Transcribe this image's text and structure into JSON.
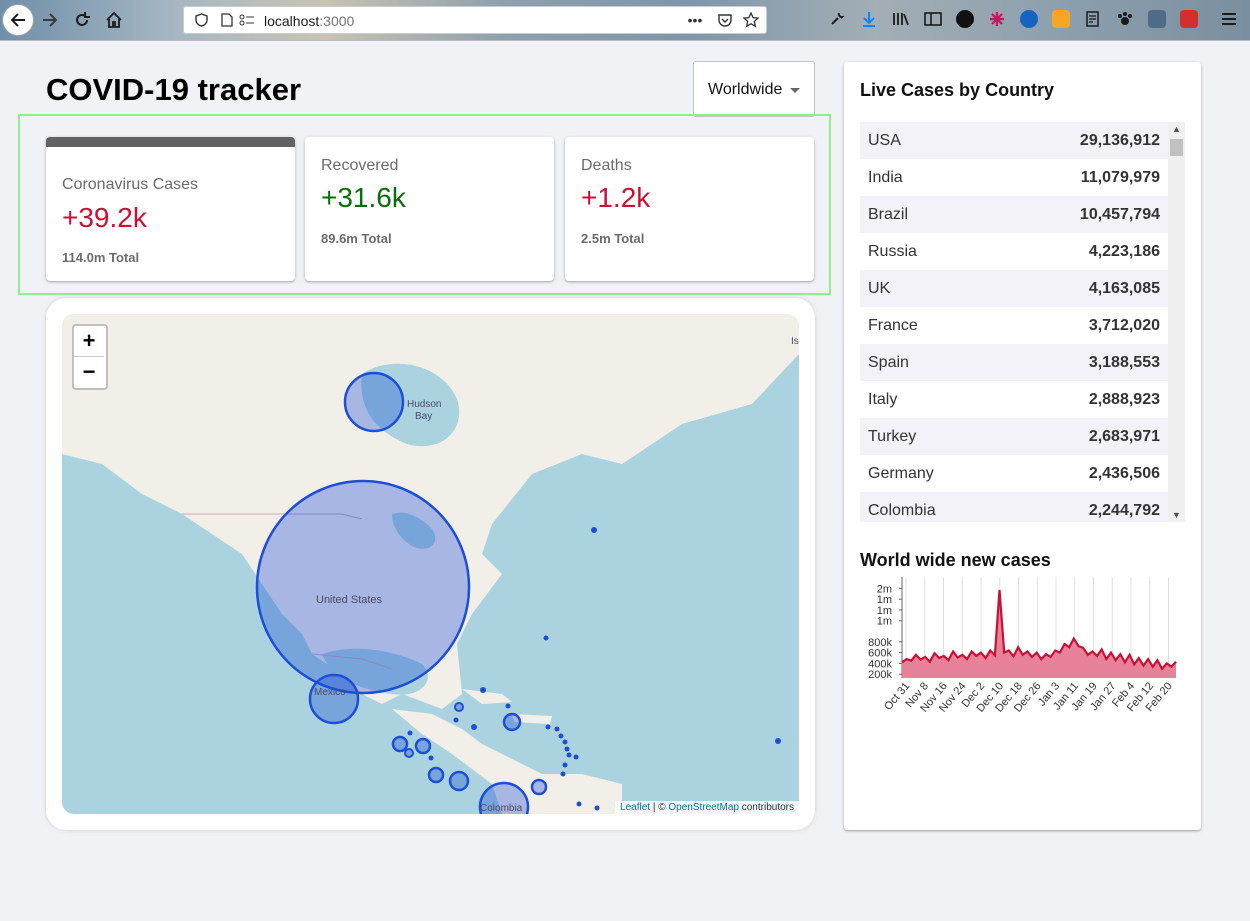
{
  "browser": {
    "url_host": "localhost",
    "url_port": ":3000"
  },
  "app": {
    "title": "COVID-19 tracker",
    "country_select": {
      "value": "Worldwide"
    }
  },
  "info_boxes": [
    {
      "title": "Coronavirus Cases",
      "value": "+39.2k",
      "total": "114.0m Total",
      "value_color": "#cc1034",
      "selected": true
    },
    {
      "title": "Recovered",
      "value": "+31.6k",
      "total": "89.6m Total",
      "value_color": "#0a6e0a",
      "selected": false
    },
    {
      "title": "Deaths",
      "value": "+1.2k",
      "total": "2.5m Total",
      "value_color": "#cc1034",
      "selected": false
    }
  ],
  "map": {
    "zoom_in": "+",
    "zoom_out": "−",
    "labels": {
      "hudson_line1": "Hudson",
      "hudson_line2": "Bay",
      "usa": "United States",
      "mexico": "Mexico",
      "colombia": "Colombia",
      "corner": "Is"
    },
    "attribution": {
      "leaflet": "Leaflet",
      "sep": " | © ",
      "osm": "OpenStreetMap",
      "suffix": " contributors"
    },
    "circle_color": "#1d4ed8"
  },
  "sidebar": {
    "table_title": "Live Cases by Country",
    "countries": [
      {
        "country": "USA",
        "cases": "29,136,912"
      },
      {
        "country": "India",
        "cases": "11,079,979"
      },
      {
        "country": "Brazil",
        "cases": "10,457,794"
      },
      {
        "country": "Russia",
        "cases": "4,223,186"
      },
      {
        "country": "UK",
        "cases": "4,163,085"
      },
      {
        "country": "France",
        "cases": "3,712,020"
      },
      {
        "country": "Spain",
        "cases": "3,188,553"
      },
      {
        "country": "Italy",
        "cases": "2,888,923"
      },
      {
        "country": "Turkey",
        "cases": "2,683,971"
      },
      {
        "country": "Germany",
        "cases": "2,436,506"
      },
      {
        "country": "Colombia",
        "cases": "2,244,792"
      }
    ],
    "graph_title": "World wide new cases"
  },
  "chart_data": {
    "type": "area",
    "title": "World wide new cases",
    "line_color": "#cc1034",
    "fill_color": "#e8829a",
    "ylim": [
      130000,
      2000000
    ],
    "y_ticks": [
      {
        "value": 1790000,
        "label": "2m"
      },
      {
        "value": 1590000,
        "label": "1m"
      },
      {
        "value": 1390000,
        "label": "1m"
      },
      {
        "value": 1190000,
        "label": "1m"
      },
      {
        "value": 800000,
        "label": "800k"
      },
      {
        "value": 600000,
        "label": "600k"
      },
      {
        "value": 400000,
        "label": "400k"
      },
      {
        "value": 200000,
        "label": "200k"
      }
    ],
    "x_ticks": [
      "Oct 31",
      "Nov 8",
      "Nov 16",
      "Nov 24",
      "Dec 2",
      "Dec 10",
      "Dec 18",
      "Dec 26",
      "Jan 3",
      "Jan 11",
      "Jan 19",
      "Jan 27",
      "Feb 4",
      "Feb 12",
      "Feb 20"
    ],
    "x": [
      "Oct 31",
      "Nov 2",
      "Nov 4",
      "Nov 6",
      "Nov 8",
      "Nov 10",
      "Nov 12",
      "Nov 14",
      "Nov 16",
      "Nov 18",
      "Nov 20",
      "Nov 22",
      "Nov 24",
      "Nov 26",
      "Nov 28",
      "Nov 30",
      "Dec 2",
      "Dec 4",
      "Dec 6",
      "Dec 8",
      "Dec 10",
      "Dec 11",
      "Dec 12",
      "Dec 14",
      "Dec 16",
      "Dec 18",
      "Dec 20",
      "Dec 22",
      "Dec 24",
      "Dec 26",
      "Dec 28",
      "Dec 30",
      "Jan 1",
      "Jan 3",
      "Jan 5",
      "Jan 7",
      "Jan 9",
      "Jan 11",
      "Jan 13",
      "Jan 15",
      "Jan 17",
      "Jan 19",
      "Jan 21",
      "Jan 23",
      "Jan 25",
      "Jan 27",
      "Jan 29",
      "Jan 31",
      "Feb 2",
      "Feb 4",
      "Feb 6",
      "Feb 8",
      "Feb 10",
      "Feb 12",
      "Feb 14",
      "Feb 16",
      "Feb 18",
      "Feb 20",
      "Feb 22",
      "Feb 24"
    ],
    "values": [
      420000,
      480000,
      450000,
      560000,
      470000,
      520000,
      430000,
      590000,
      500000,
      540000,
      460000,
      620000,
      510000,
      560000,
      480000,
      620000,
      540000,
      600000,
      500000,
      640000,
      550000,
      1760000,
      600000,
      640000,
      530000,
      700000,
      560000,
      620000,
      520000,
      600000,
      480000,
      570000,
      520000,
      640000,
      600000,
      760000,
      700000,
      860000,
      720000,
      690000,
      560000,
      620000,
      540000,
      660000,
      480000,
      600000,
      460000,
      570000,
      420000,
      560000,
      380000,
      500000,
      360000,
      480000,
      340000,
      460000,
      300000,
      400000,
      340000,
      430000
    ]
  }
}
